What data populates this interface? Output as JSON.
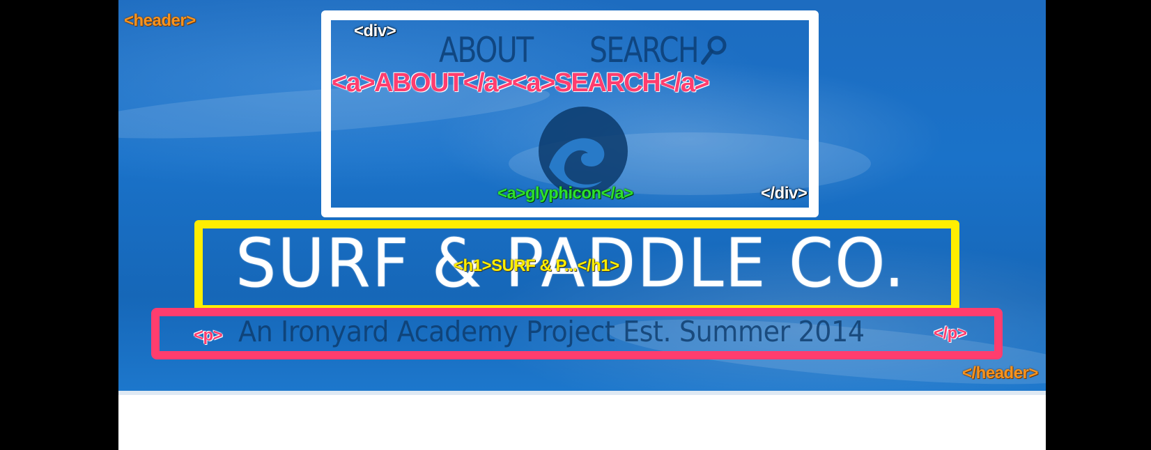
{
  "tags": {
    "header_open": "<header>",
    "header_close": "</header>",
    "div_open": "<div>",
    "div_close": "</div>",
    "nav_links": "<a>ABOUT</a><a>SEARCH</a>",
    "glyph_link": "<a>glyphicon</a>",
    "h1": "<h1>SURF & P...</h1>",
    "p_open": "<p>",
    "p_close": "</p>"
  },
  "nav": {
    "about": "ABOUT",
    "search": "SEARCH"
  },
  "site": {
    "title": "SURF & PADDLE CO.",
    "tagline": "An Ironyard Academy Project Est. Summer 2014"
  },
  "icons": {
    "search": "search-icon",
    "logo": "wave-logo-icon"
  },
  "colors": {
    "header_tag": "#f7931e",
    "div_box": "#ffffff",
    "h1_box": "#ffee00",
    "p_box": "#ff3d6e",
    "link_tag": "#2ee02e",
    "hero_blue": "#1a72c9"
  }
}
